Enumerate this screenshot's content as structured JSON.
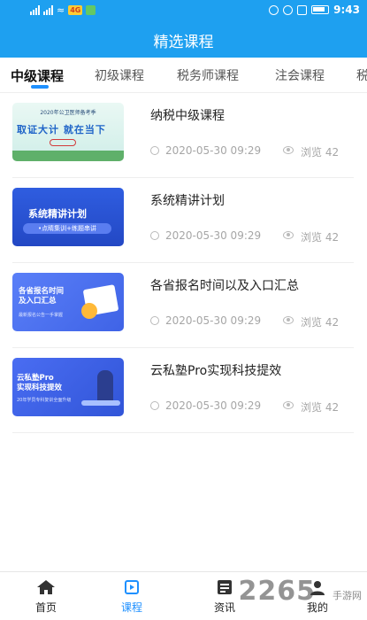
{
  "status_bar": {
    "badge": "4G",
    "time": "9:43"
  },
  "header": {
    "title": "精选课程"
  },
  "tabs": [
    {
      "label": "中级课程",
      "active": true
    },
    {
      "label": "初级课程",
      "active": false
    },
    {
      "label": "税务师课程",
      "active": false
    },
    {
      "label": "注会课程",
      "active": false
    },
    {
      "label": "税",
      "active": false
    }
  ],
  "courses": [
    {
      "title": "纳税中级课程",
      "date": "2020-05-30 09:29",
      "views": "浏览 42",
      "thumb": {
        "top": "2020年公卫医师备考季",
        "big": "取证大计 就在当下"
      }
    },
    {
      "title": "系统精讲计划",
      "date": "2020-05-30 09:29",
      "views": "浏览 42",
      "thumb": {
        "big": "系统精讲计划",
        "bar": "•点睛集训+练题串讲"
      }
    },
    {
      "title": "各省报名时间以及入口汇总",
      "date": "2020-05-30 09:29",
      "views": "浏览 42",
      "thumb": {
        "big_line1": "各省报名时间",
        "big_line2": "及入口汇总",
        "small": "最新报名公告一手掌握"
      }
    },
    {
      "title": "云私塾Pro实现科技提效",
      "date": "2020-05-30 09:29",
      "views": "浏览 42",
      "thumb": {
        "big_line1": "云私塾Pro",
        "big_line2": "实现科技提效",
        "small": "20年学员专科复训全面升级"
      }
    }
  ],
  "bottom_nav": [
    {
      "label": "首页",
      "icon": "home-icon",
      "active": false
    },
    {
      "label": "课程",
      "icon": "course-play-icon",
      "active": true
    },
    {
      "label": "资讯",
      "icon": "news-icon",
      "active": false
    },
    {
      "label": "我的",
      "icon": "profile-icon",
      "active": false
    }
  ],
  "watermark": {
    "main": "2265",
    "sub": "手游网"
  },
  "colors": {
    "primary": "#1ea0f0",
    "accent": "#1e90ff",
    "meta": "#a6a6a6"
  }
}
